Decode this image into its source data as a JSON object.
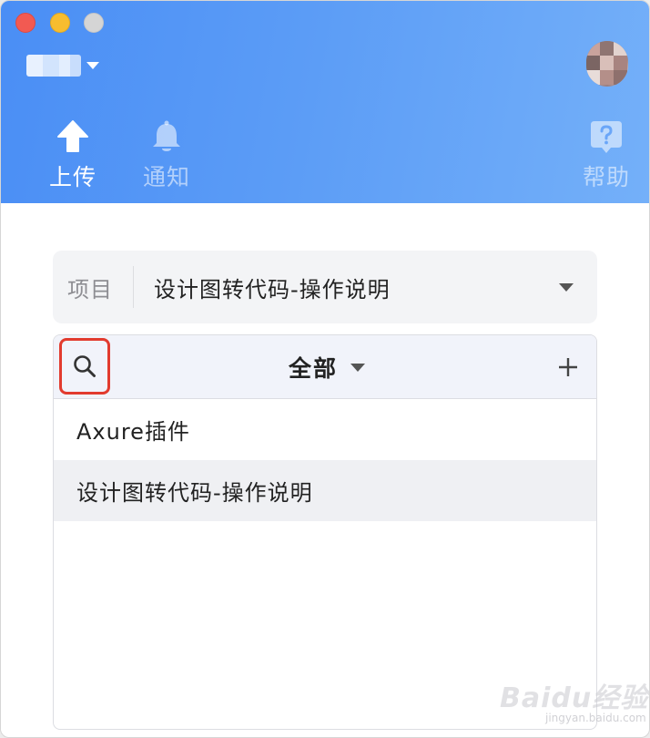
{
  "header": {
    "nav": {
      "upload_label": "上传",
      "notify_label": "通知",
      "help_label": "帮助"
    }
  },
  "project": {
    "label": "项目",
    "value": "设计图转代码-操作说明"
  },
  "panel": {
    "filter_label": "全部",
    "items": [
      {
        "label": "Axure插件",
        "selected": false
      },
      {
        "label": "设计图转代码-操作说明",
        "selected": true
      }
    ]
  },
  "watermark": {
    "brand": "Baidu经验",
    "url": "jingyan.baidu.com"
  },
  "colors": {
    "header_gradient_start": "#4a8ef5",
    "header_gradient_end": "#74b0f9",
    "highlight_border": "#e23b2e",
    "toolbar_bg": "#f1f3fa",
    "selected_row_bg": "#eff0f3"
  },
  "icons": {
    "upload": "arrow-up-icon",
    "notify": "bell-icon",
    "help": "question-bubble-icon",
    "search": "search-icon",
    "add": "plus-icon"
  }
}
